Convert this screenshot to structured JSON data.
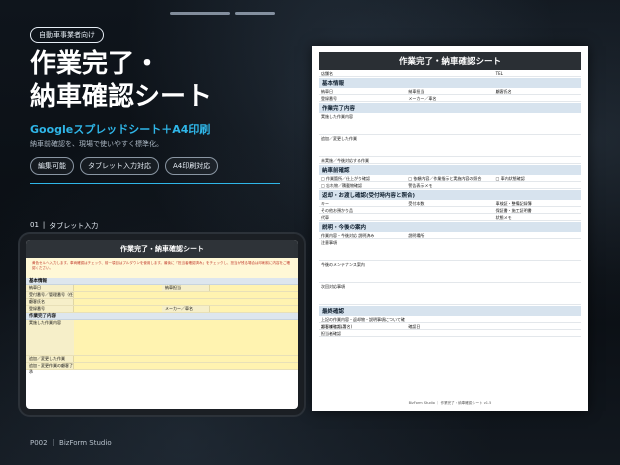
{
  "hero": {
    "badge": "自動車事業者向け",
    "title_line1": "作業完了・",
    "title_line2": "納車確認シート",
    "subtitle": "Googleスプレッドシート＋A4印刷",
    "description": "納車前確認を、現場で使いやすく標準化。",
    "tags": [
      "編集可能",
      "タブレット入力対応",
      "A4印刷対応"
    ]
  },
  "section": {
    "number": "01",
    "label": "タブレット入力"
  },
  "footer": "P002 ｜ BizForm Studio",
  "tablet": {
    "title": "作業完了・納車確認シート",
    "note": "黄色セルへ入力します。車両確認はチェック、前一項目はプルダウンを使用します。最後に「担当者確認済み」をチェックし、担当が残る場合は印刷前に内容をご確認ください。",
    "rows": [
      {
        "label": "基本情報",
        "section": true
      },
      {
        "label": "納車日",
        "label2": "納車担当"
      },
      {
        "label": "受付番号／管理番号（任意）"
      },
      {
        "label": "顧客氏名"
      },
      {
        "label": "登録番号",
        "label2": "メーカー／車名"
      },
      {
        "label": "作業完了内容",
        "section": true
      },
      {
        "label": "実施した作業内容",
        "big": true
      },
      {
        "label": "追加／変更した作業"
      },
      {
        "label": "追加・変更作業の顧客了承"
      }
    ]
  },
  "paper": {
    "title": "作業完了・納車確認シート",
    "rows": [
      {
        "type": "row",
        "cells": [
          "店舗名",
          "",
          "TEL"
        ]
      },
      {
        "type": "sec",
        "text": "基本情報"
      },
      {
        "type": "row",
        "cells": [
          "納車日",
          "納車担当",
          "顧客氏名"
        ]
      },
      {
        "type": "row",
        "cells": [
          "登録番号",
          "メーカー／車名",
          ""
        ]
      },
      {
        "type": "sec",
        "text": "作業完了内容"
      },
      {
        "type": "block",
        "text": "実施した作業内容"
      },
      {
        "type": "block",
        "text": "追加／変更した作業"
      },
      {
        "type": "row",
        "cells": [
          "未実施／今後対応する作業",
          "",
          ""
        ]
      },
      {
        "type": "sec",
        "text": "納車前確認"
      },
      {
        "type": "row",
        "cells": [
          "□ 作業箇所／仕上がり確認",
          "□ 依頼内容／作業指示と実施内容の照合",
          "□ 車内状態確認"
        ]
      },
      {
        "type": "row",
        "cells": [
          "□ 忘れ物／積載物確認",
          "警告表示メモ",
          ""
        ]
      },
      {
        "type": "sec",
        "text": "返却・お渡し確認(受付時内容と照合)"
      },
      {
        "type": "row",
        "cells": [
          "キー",
          "受付本数",
          "車検証・整備記録簿"
        ]
      },
      {
        "type": "row",
        "cells": [
          "その他お預かり品",
          "",
          "保証書・施工証明書"
        ]
      },
      {
        "type": "row",
        "cells": [
          "代車",
          "",
          "状態メモ"
        ]
      },
      {
        "type": "sec",
        "text": "説明・今後の案内"
      },
      {
        "type": "row",
        "cells": [
          "作業内容・今後対応 説明済み",
          "説明場所",
          ""
        ]
      },
      {
        "type": "block",
        "text": "注意事項"
      },
      {
        "type": "block",
        "text": "今後のメンテナンス案内"
      },
      {
        "type": "block",
        "text": "次回対応事項"
      },
      {
        "type": "sec",
        "text": "最終確認"
      },
      {
        "type": "row",
        "cells": [
          "上記の作業内容・返却物・説明事項について確認しました。",
          "",
          ""
        ]
      },
      {
        "type": "row",
        "cells": [
          "お客様確認(署名)",
          "確認日",
          ""
        ]
      },
      {
        "type": "row",
        "cells": [
          "担当者確認",
          "",
          ""
        ]
      }
    ],
    "footer": "BizForm Studio ｜ 作業完了・納車確認シート v1.5"
  }
}
